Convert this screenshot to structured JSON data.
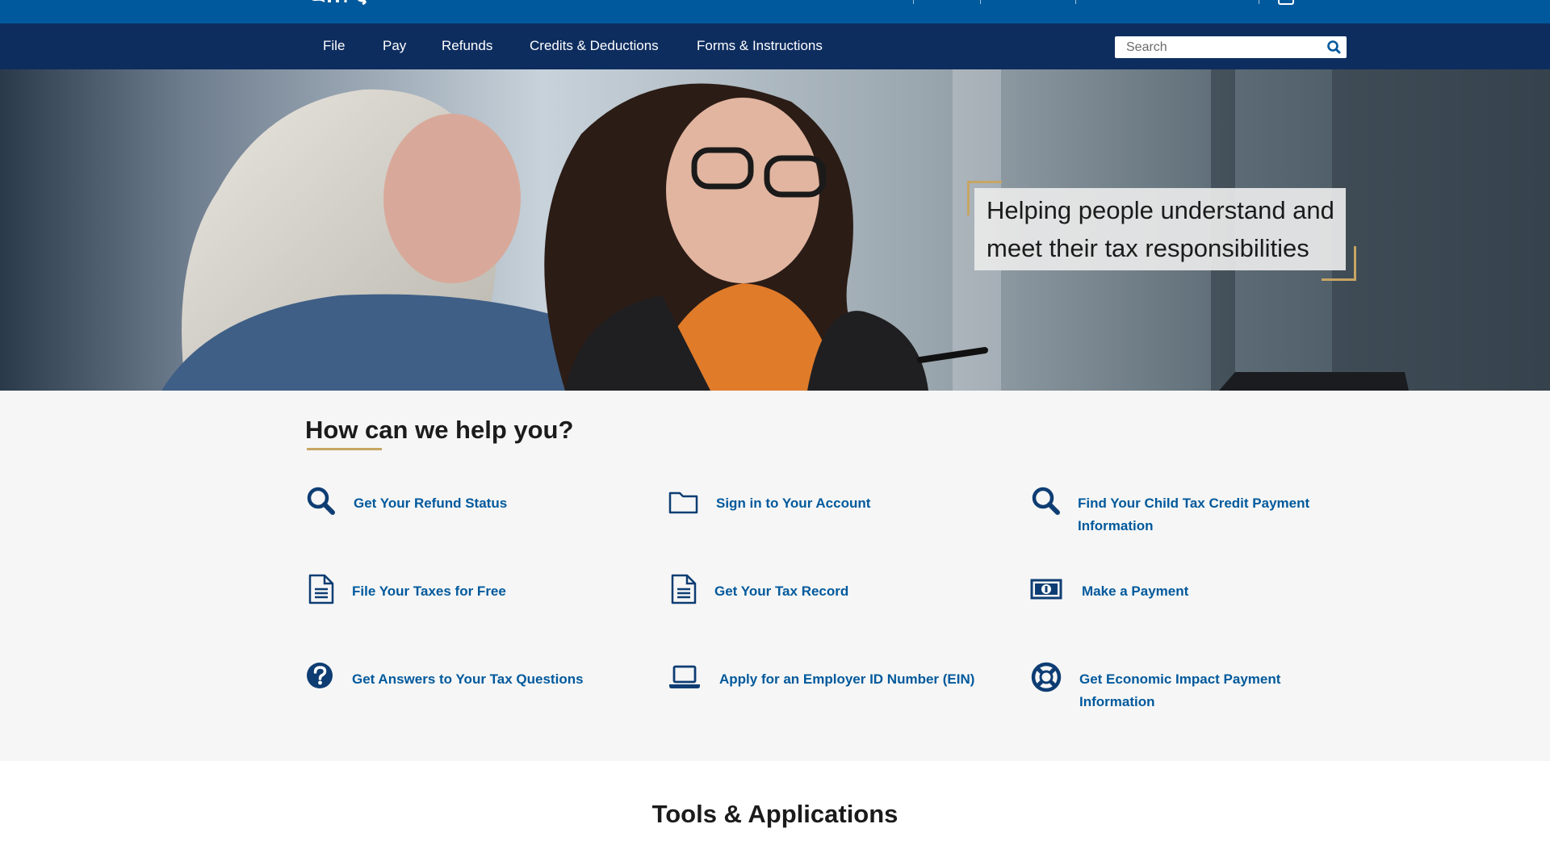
{
  "brand": {
    "logo_name": "irs-logo"
  },
  "nav": {
    "items": [
      "File",
      "Pay",
      "Refunds",
      "Credits & Deductions",
      "Forms & Instructions"
    ]
  },
  "search": {
    "placeholder": "Search",
    "value": ""
  },
  "hero": {
    "tagline": "Helping people understand and meet their tax responsibilities"
  },
  "help": {
    "title": "How can we help you?",
    "links": [
      {
        "label": "Get Your Refund Status",
        "icon": "search-icon"
      },
      {
        "label": "Sign in to Your Account",
        "icon": "folder-icon"
      },
      {
        "label": "Find Your Child Tax Credit Payment Information",
        "icon": "search-icon"
      },
      {
        "label": "File Your Taxes for Free",
        "icon": "document-icon"
      },
      {
        "label": "Get Your Tax Record",
        "icon": "document-icon"
      },
      {
        "label": "Make a Payment",
        "icon": "money-icon"
      },
      {
        "label": "Get Answers to Your Tax Questions",
        "icon": "question-icon"
      },
      {
        "label": "Apply for an Employer ID Number (EIN)",
        "icon": "laptop-icon"
      },
      {
        "label": "Get Economic Impact Payment Information",
        "icon": "life-ring-icon"
      }
    ]
  },
  "tools": {
    "title": "Tools & Applications"
  },
  "colors": {
    "nav_bg": "#0e2d5f",
    "topbar_bg": "#00599c",
    "link": "#00599c",
    "accent": "#c7a564"
  }
}
